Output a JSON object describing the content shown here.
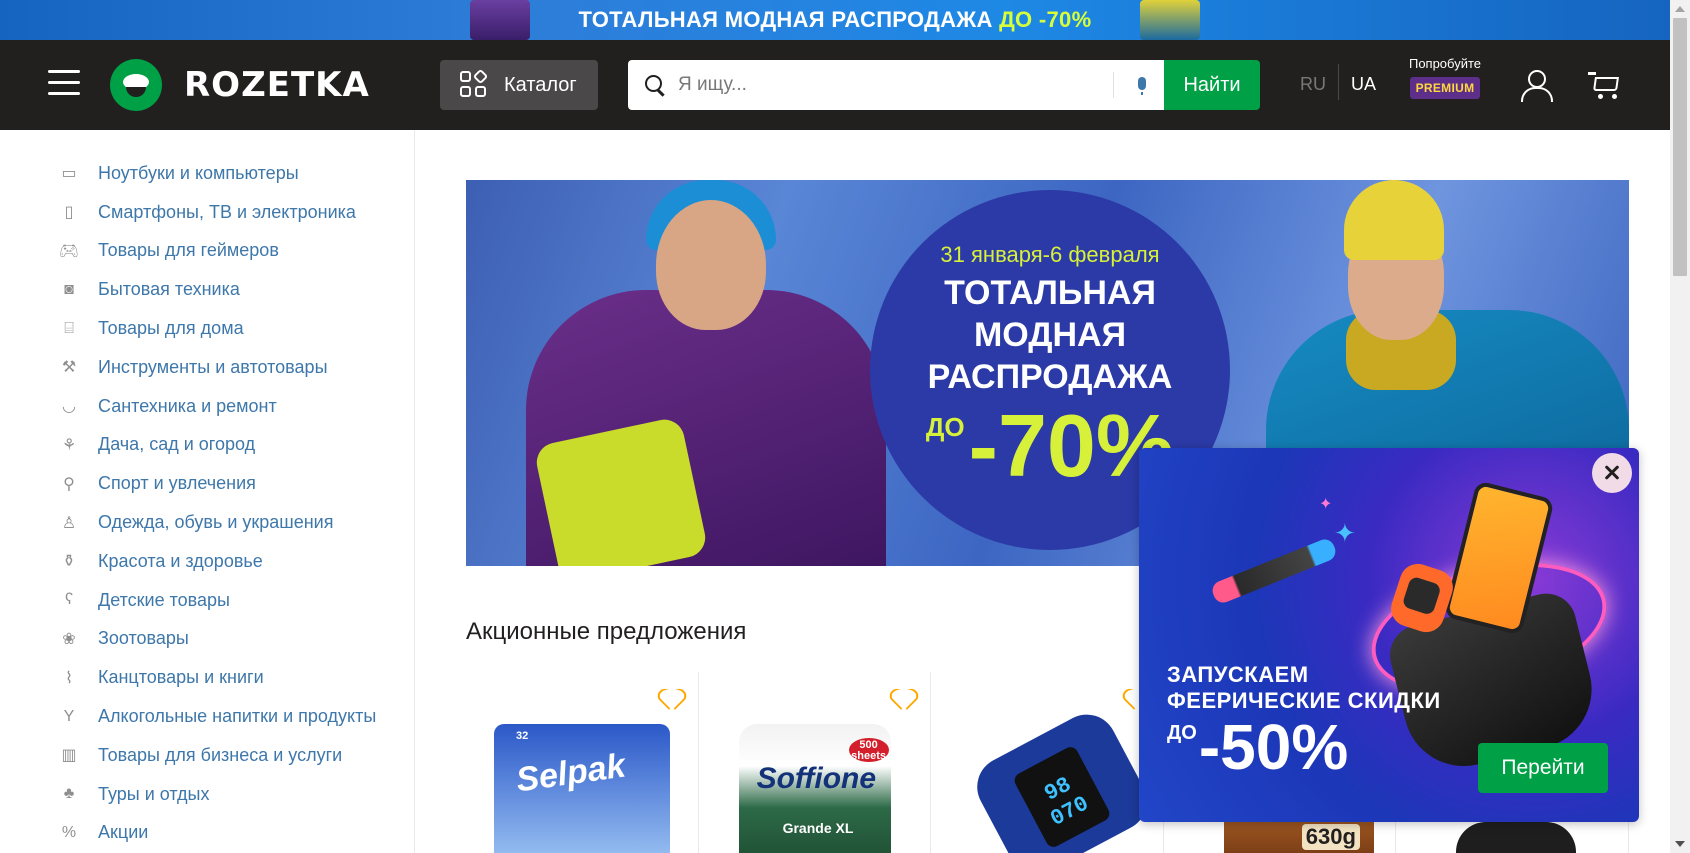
{
  "promo_strip": {
    "text": "ТОТАЛЬНАЯ МОДНАЯ РАСПРОДАЖА",
    "accent": "ДО -70%"
  },
  "header": {
    "logo_text": "ROZETKA",
    "catalog_label": "Каталог",
    "search": {
      "placeholder": "Я ищу...",
      "button_label": "Найти"
    },
    "languages": {
      "ru": "RU",
      "ua": "UA"
    },
    "premium": {
      "try_label": "Попробуйте",
      "badge": "PREMIUM"
    }
  },
  "sidebar": {
    "items": [
      {
        "label": "Ноутбуки и компьютеры",
        "icon": "laptop-icon"
      },
      {
        "label": "Смартфоны, ТВ и электроника",
        "icon": "smartphone-icon"
      },
      {
        "label": "Товары для геймеров",
        "icon": "gamepad-icon"
      },
      {
        "label": "Бытовая техника",
        "icon": "washing-machine-icon"
      },
      {
        "label": "Товары для дома",
        "icon": "armchair-icon"
      },
      {
        "label": "Инструменты и автотовары",
        "icon": "drill-icon"
      },
      {
        "label": "Сантехника и ремонт",
        "icon": "bathtub-icon"
      },
      {
        "label": "Дача, сад и огород",
        "icon": "garden-tools-icon"
      },
      {
        "label": "Спорт и увлечения",
        "icon": "racket-icon"
      },
      {
        "label": "Одежда, обувь и украшения",
        "icon": "tshirt-icon"
      },
      {
        "label": "Красота и здоровье",
        "icon": "cosmetics-icon"
      },
      {
        "label": "Детские товары",
        "icon": "teddy-bear-icon"
      },
      {
        "label": "Зоотовары",
        "icon": "paw-icon"
      },
      {
        "label": "Канцтовары и книги",
        "icon": "paperclip-icon"
      },
      {
        "label": "Алкогольные напитки и продукты",
        "icon": "cocktail-icon"
      },
      {
        "label": "Товары для бизнеса и услуги",
        "icon": "barcode-icon"
      },
      {
        "label": "Туры и отдых",
        "icon": "palm-tree-icon"
      },
      {
        "label": "Акции",
        "icon": "percent-icon"
      }
    ]
  },
  "banner": {
    "date": "31 января-6 февраля",
    "title_lines": [
      "ТОТАЛЬНАЯ",
      "МОДНАЯ",
      "РАСПРОДАЖА"
    ],
    "discount_prefix": "ДО",
    "discount_value": "-70%"
  },
  "section": {
    "title": "Акционные предложения"
  },
  "products": [
    {
      "brand": "Selpak",
      "note": "32"
    },
    {
      "brand": "Soffione",
      "seal": "500 sheets",
      "sub": "Grande XL"
    },
    {
      "screen": "98 070"
    },
    {
      "weight": "630g"
    },
    {}
  ],
  "popup": {
    "line1": "ЗАПУСКАЕМ",
    "line2": "ФЕЕРИЧЕСКИЕ СКИДКИ",
    "discount_prefix": "ДО",
    "discount_value": "-50%",
    "button_label": "Перейти"
  },
  "colors": {
    "brand_green": "#00a046",
    "header_bg": "#221f1f",
    "link_blue": "#3e77aa",
    "accent_lime": "#d7f03a",
    "heart_orange": "#ffa900"
  }
}
